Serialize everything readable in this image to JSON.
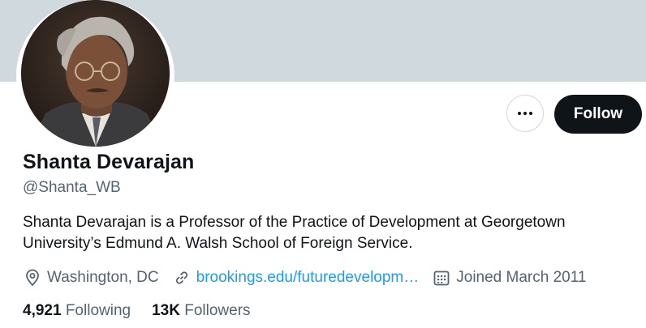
{
  "profile": {
    "name": "Shanta Devarajan",
    "handle": "@Shanta_WB",
    "bio": "Shanta Devarajan is a Professor of the Practice of Development at Georgetown University’s Edmund A. Walsh School of Foreign Service.",
    "location": "Washington, DC",
    "website": "brookings.edu/futuredevelopm…",
    "joined": "Joined March 2011"
  },
  "actions": {
    "follow_label": "Follow",
    "more_icon": "more-horizontal-icon"
  },
  "stats": {
    "following_count": "4,921",
    "following_label": "Following",
    "followers_count": "13K",
    "followers_label": "Followers"
  },
  "colors": {
    "banner": "#cfd9de",
    "link": "#1d9bf0",
    "secondary_text": "#536471",
    "follow_button": "#0f1419"
  }
}
